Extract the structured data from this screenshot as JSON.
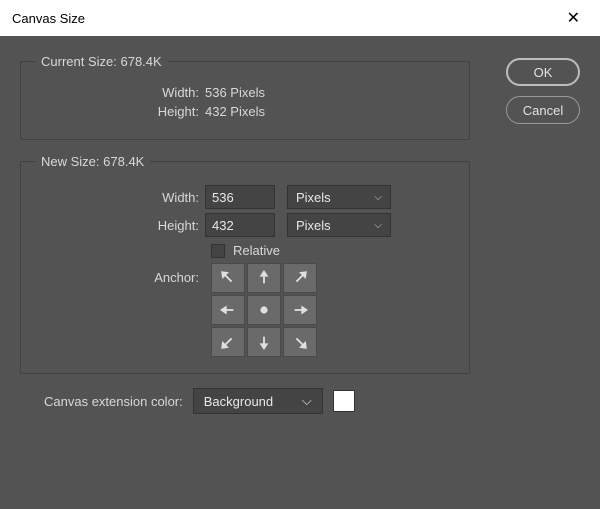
{
  "titlebar": {
    "title": "Canvas Size"
  },
  "buttons": {
    "ok": "OK",
    "cancel": "Cancel"
  },
  "current": {
    "legend_prefix": "Current Size: ",
    "size": "678.4K",
    "width_label": "Width:",
    "width_value": "536 Pixels",
    "height_label": "Height:",
    "height_value": "432 Pixels"
  },
  "new": {
    "legend_prefix": "New Size: ",
    "size": "678.4K",
    "width_label": "Width:",
    "width_value": "536",
    "width_unit": "Pixels",
    "height_label": "Height:",
    "height_value": "432",
    "height_unit": "Pixels",
    "relative_label": "Relative",
    "anchor_label": "Anchor:"
  },
  "extension": {
    "label": "Canvas extension color:",
    "value": "Background",
    "swatch": "#ffffff"
  }
}
